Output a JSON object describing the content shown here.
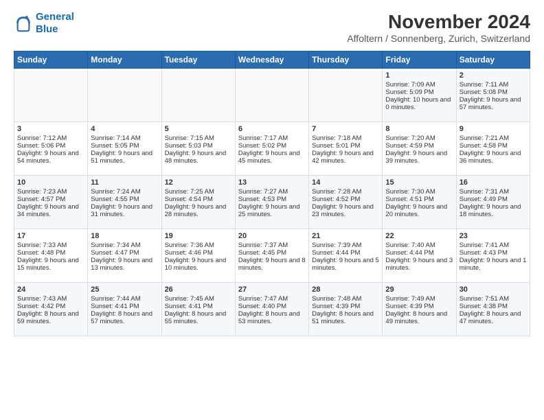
{
  "header": {
    "logo_line1": "General",
    "logo_line2": "Blue",
    "title": "November 2024",
    "subtitle": "Affoltern / Sonnenberg, Zurich, Switzerland"
  },
  "days_of_week": [
    "Sunday",
    "Monday",
    "Tuesday",
    "Wednesday",
    "Thursday",
    "Friday",
    "Saturday"
  ],
  "weeks": [
    [
      {
        "day": "",
        "info": ""
      },
      {
        "day": "",
        "info": ""
      },
      {
        "day": "",
        "info": ""
      },
      {
        "day": "",
        "info": ""
      },
      {
        "day": "",
        "info": ""
      },
      {
        "day": "1",
        "info": "Sunrise: 7:09 AM\nSunset: 5:09 PM\nDaylight: 10 hours and 0 minutes."
      },
      {
        "day": "2",
        "info": "Sunrise: 7:11 AM\nSunset: 5:08 PM\nDaylight: 9 hours and 57 minutes."
      }
    ],
    [
      {
        "day": "3",
        "info": "Sunrise: 7:12 AM\nSunset: 5:06 PM\nDaylight: 9 hours and 54 minutes."
      },
      {
        "day": "4",
        "info": "Sunrise: 7:14 AM\nSunset: 5:05 PM\nDaylight: 9 hours and 51 minutes."
      },
      {
        "day": "5",
        "info": "Sunrise: 7:15 AM\nSunset: 5:03 PM\nDaylight: 9 hours and 48 minutes."
      },
      {
        "day": "6",
        "info": "Sunrise: 7:17 AM\nSunset: 5:02 PM\nDaylight: 9 hours and 45 minutes."
      },
      {
        "day": "7",
        "info": "Sunrise: 7:18 AM\nSunset: 5:01 PM\nDaylight: 9 hours and 42 minutes."
      },
      {
        "day": "8",
        "info": "Sunrise: 7:20 AM\nSunset: 4:59 PM\nDaylight: 9 hours and 39 minutes."
      },
      {
        "day": "9",
        "info": "Sunrise: 7:21 AM\nSunset: 4:58 PM\nDaylight: 9 hours and 36 minutes."
      }
    ],
    [
      {
        "day": "10",
        "info": "Sunrise: 7:23 AM\nSunset: 4:57 PM\nDaylight: 9 hours and 34 minutes."
      },
      {
        "day": "11",
        "info": "Sunrise: 7:24 AM\nSunset: 4:55 PM\nDaylight: 9 hours and 31 minutes."
      },
      {
        "day": "12",
        "info": "Sunrise: 7:25 AM\nSunset: 4:54 PM\nDaylight: 9 hours and 28 minutes."
      },
      {
        "day": "13",
        "info": "Sunrise: 7:27 AM\nSunset: 4:53 PM\nDaylight: 9 hours and 25 minutes."
      },
      {
        "day": "14",
        "info": "Sunrise: 7:28 AM\nSunset: 4:52 PM\nDaylight: 9 hours and 23 minutes."
      },
      {
        "day": "15",
        "info": "Sunrise: 7:30 AM\nSunset: 4:51 PM\nDaylight: 9 hours and 20 minutes."
      },
      {
        "day": "16",
        "info": "Sunrise: 7:31 AM\nSunset: 4:49 PM\nDaylight: 9 hours and 18 minutes."
      }
    ],
    [
      {
        "day": "17",
        "info": "Sunrise: 7:33 AM\nSunset: 4:48 PM\nDaylight: 9 hours and 15 minutes."
      },
      {
        "day": "18",
        "info": "Sunrise: 7:34 AM\nSunset: 4:47 PM\nDaylight: 9 hours and 13 minutes."
      },
      {
        "day": "19",
        "info": "Sunrise: 7:36 AM\nSunset: 4:46 PM\nDaylight: 9 hours and 10 minutes."
      },
      {
        "day": "20",
        "info": "Sunrise: 7:37 AM\nSunset: 4:45 PM\nDaylight: 9 hours and 8 minutes."
      },
      {
        "day": "21",
        "info": "Sunrise: 7:39 AM\nSunset: 4:44 PM\nDaylight: 9 hours and 5 minutes."
      },
      {
        "day": "22",
        "info": "Sunrise: 7:40 AM\nSunset: 4:44 PM\nDaylight: 9 hours and 3 minutes."
      },
      {
        "day": "23",
        "info": "Sunrise: 7:41 AM\nSunset: 4:43 PM\nDaylight: 9 hours and 1 minute."
      }
    ],
    [
      {
        "day": "24",
        "info": "Sunrise: 7:43 AM\nSunset: 4:42 PM\nDaylight: 8 hours and 59 minutes."
      },
      {
        "day": "25",
        "info": "Sunrise: 7:44 AM\nSunset: 4:41 PM\nDaylight: 8 hours and 57 minutes."
      },
      {
        "day": "26",
        "info": "Sunrise: 7:45 AM\nSunset: 4:41 PM\nDaylight: 8 hours and 55 minutes."
      },
      {
        "day": "27",
        "info": "Sunrise: 7:47 AM\nSunset: 4:40 PM\nDaylight: 8 hours and 53 minutes."
      },
      {
        "day": "28",
        "info": "Sunrise: 7:48 AM\nSunset: 4:39 PM\nDaylight: 8 hours and 51 minutes."
      },
      {
        "day": "29",
        "info": "Sunrise: 7:49 AM\nSunset: 4:39 PM\nDaylight: 8 hours and 49 minutes."
      },
      {
        "day": "30",
        "info": "Sunrise: 7:51 AM\nSunset: 4:38 PM\nDaylight: 8 hours and 47 minutes."
      }
    ]
  ]
}
